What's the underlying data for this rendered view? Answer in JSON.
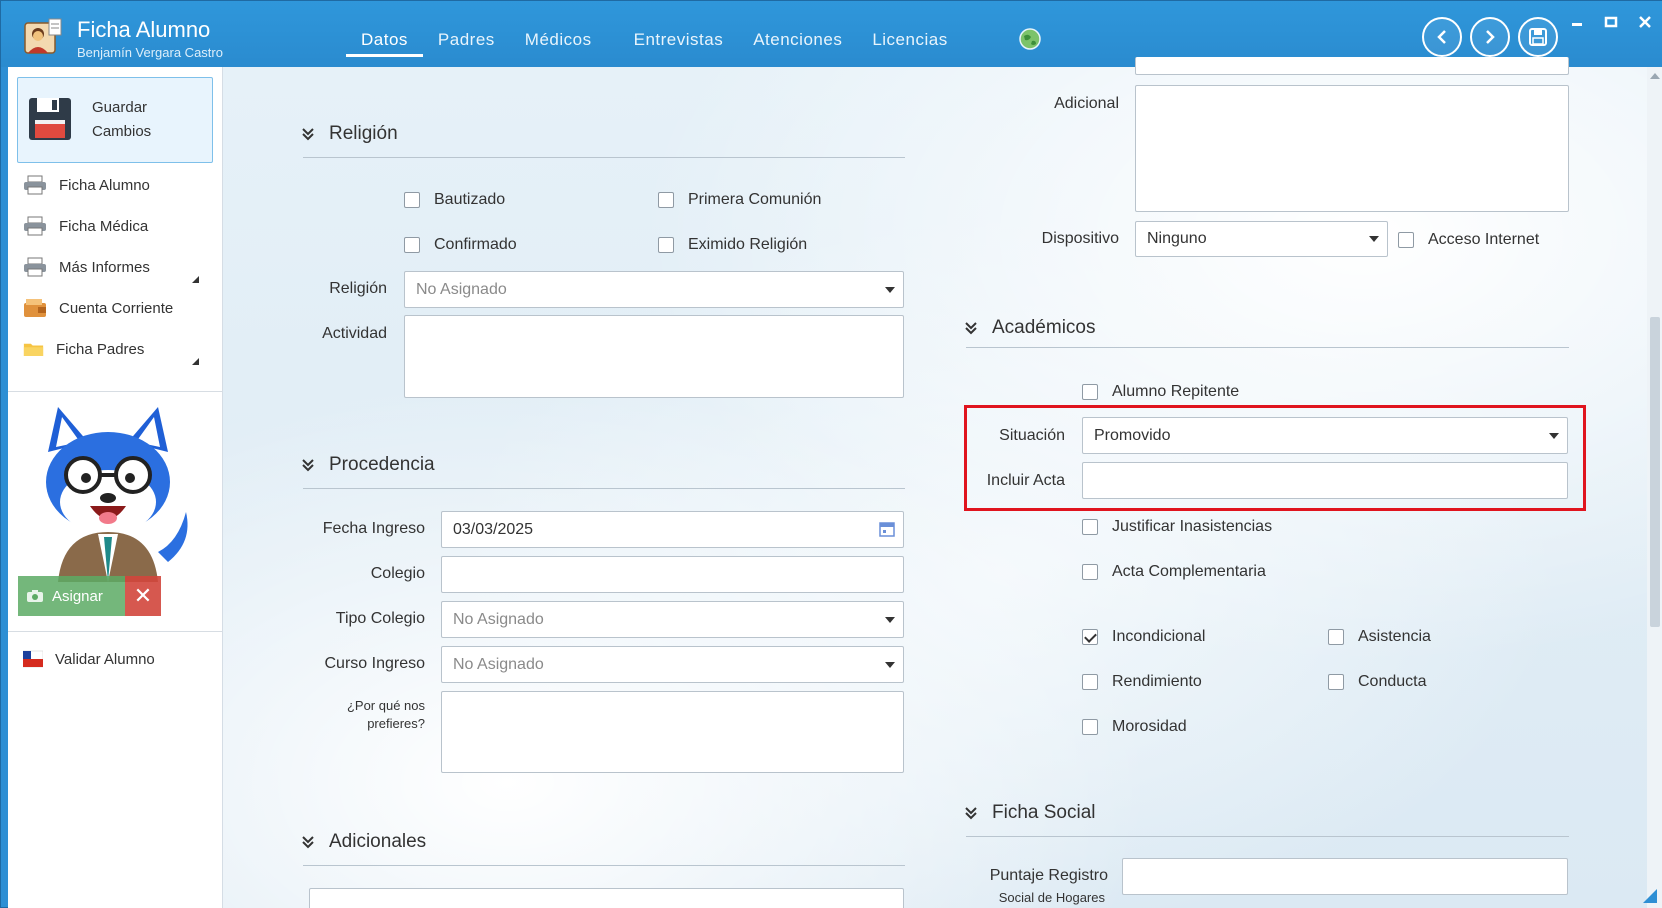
{
  "window": {
    "title": "Ficha Alumno",
    "subtitle": "Benjamín Vergara Castro",
    "tabs": [
      {
        "label": "Datos",
        "active": true
      },
      {
        "label": "Padres"
      },
      {
        "label": "Médicos"
      },
      {
        "label": "Entrevistas"
      },
      {
        "label": "Atenciones"
      },
      {
        "label": "Licencias"
      }
    ],
    "icons": {
      "prev": "chevron-left-icon",
      "next": "chevron-right-icon",
      "save": "floppy-disk-icon",
      "globe": "globe-icon"
    }
  },
  "sidebar": {
    "save_label": "Guardar Cambios",
    "items": [
      {
        "label": "Ficha Alumno",
        "icon": "printer-icon"
      },
      {
        "label": "Ficha Médica",
        "icon": "printer-icon"
      },
      {
        "label": "Más Informes",
        "icon": "printer-icon"
      },
      {
        "label": "Cuenta Corriente",
        "icon": "wallet-icon"
      },
      {
        "label": "Ficha Padres",
        "icon": "folder-icon"
      }
    ],
    "assign_label": "Asignar",
    "validate_label": "Validar Alumno"
  },
  "religion": {
    "title": "Religión",
    "checks": [
      {
        "label": "Bautizado",
        "checked": false
      },
      {
        "label": "Primera Comunión",
        "checked": false
      },
      {
        "label": "Confirmado",
        "checked": false
      },
      {
        "label": "Eximido Religión",
        "checked": false
      }
    ],
    "religion_label": "Religión",
    "religion_value": "No Asignado",
    "activity_label": "Actividad"
  },
  "procedencia": {
    "title": "Procedencia",
    "fecha_label": "Fecha Ingreso",
    "fecha_value": "03/03/2025",
    "colegio_label": "Colegio",
    "tipo_label": "Tipo Colegio",
    "tipo_value": "No Asignado",
    "curso_label": "Curso Ingreso",
    "curso_value": "No Asignado",
    "porque_label_1": "¿Por qué nos",
    "porque_label_2": "prefieres?"
  },
  "adicionales": {
    "title": "Adicionales"
  },
  "right_top": {
    "adicional_label": "Adicional",
    "dispositivo_label": "Dispositivo",
    "dispositivo_value": "Ninguno",
    "acceso_label": "Acceso Internet"
  },
  "academicos": {
    "title": "Académicos",
    "repitente_label": "Alumno Repitente",
    "situacion_label": "Situación",
    "situacion_value": "Promovido",
    "acta_label": "Incluir Acta",
    "justificar_label": "Justificar Inasistencias",
    "complementaria_label": "Acta Complementaria",
    "checks": [
      {
        "label": "Incondicional",
        "checked": true
      },
      {
        "label": "Asistencia",
        "checked": false
      },
      {
        "label": "Rendimiento",
        "checked": false
      },
      {
        "label": "Conducta",
        "checked": false
      },
      {
        "label": "Morosidad",
        "checked": false
      }
    ]
  },
  "ficha_social": {
    "title": "Ficha Social",
    "puntaje_label_1": "Puntaje Registro",
    "puntaje_label_2": "Social de Hogares"
  },
  "colors": {
    "titlebar": "#2e8fd4",
    "highlight": "#e0141e"
  }
}
